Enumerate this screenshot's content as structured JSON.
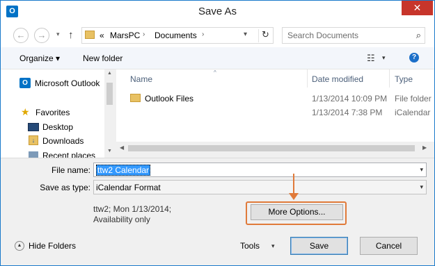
{
  "window": {
    "title": "Save As",
    "close": "✕",
    "app_icon": "O"
  },
  "nav": {
    "back_icon": "←",
    "forward_icon": "→",
    "recent_icon": "▾",
    "up_icon": "↑",
    "address": {
      "prefix": "«",
      "segments": [
        "MarsPC",
        "Documents"
      ],
      "chevron": "›",
      "dropdown": "▾",
      "refresh_icon": "↻"
    },
    "search": {
      "placeholder": "Search Documents",
      "icon": "⌕"
    }
  },
  "toolbar": {
    "organize_label": "Organize ▾",
    "new_folder_label": "New folder",
    "view_icon": "☷",
    "view_dropdown": "▾",
    "help_icon": "?"
  },
  "sidebar": {
    "items": [
      {
        "label": "Microsoft Outlook",
        "icon": "outlook-icon",
        "glyph": "O"
      },
      {
        "label": "Favorites",
        "icon": "star-icon",
        "glyph": "★"
      },
      {
        "label": "Desktop",
        "icon": "desktop-icon",
        "glyph": ""
      },
      {
        "label": "Downloads",
        "icon": "downloads-icon",
        "glyph": "↓"
      },
      {
        "label": "Recent places",
        "icon": "recent-places-icon",
        "glyph": ""
      }
    ]
  },
  "files": {
    "columns": [
      "Name",
      "Date modified",
      "Type"
    ],
    "sort_caret": "^",
    "rows": [
      {
        "name": "Outlook Files",
        "date": "1/13/2014 10:09 PM",
        "type": "File folder"
      },
      {
        "name": "",
        "date": "1/13/2014 7:38 PM",
        "type": "iCalendar"
      }
    ]
  },
  "scroll": {
    "up": "▲",
    "down": "▼",
    "left": "◀",
    "right": "▶"
  },
  "form": {
    "file_name_label": "File name:",
    "file_name_value": "ttw2 Calendar",
    "save_type_label": "Save as type:",
    "save_type_value": "iCalendar Format",
    "combo_dropdown": "▾",
    "meta_line1": "ttw2; Mon 1/13/2014;",
    "meta_line2": "Availability only",
    "more_options_label": "More Options..."
  },
  "footer": {
    "hide_folders_icon": "▲",
    "hide_folders_label": "Hide Folders",
    "tools_label": "Tools",
    "tools_dropdown": "▾",
    "save_label": "Save",
    "cancel_label": "Cancel"
  },
  "colors": {
    "accent": "#1979ca",
    "highlight_arrow": "#e07a3a",
    "close_red": "#c7352b",
    "selection": "#3399ff"
  }
}
